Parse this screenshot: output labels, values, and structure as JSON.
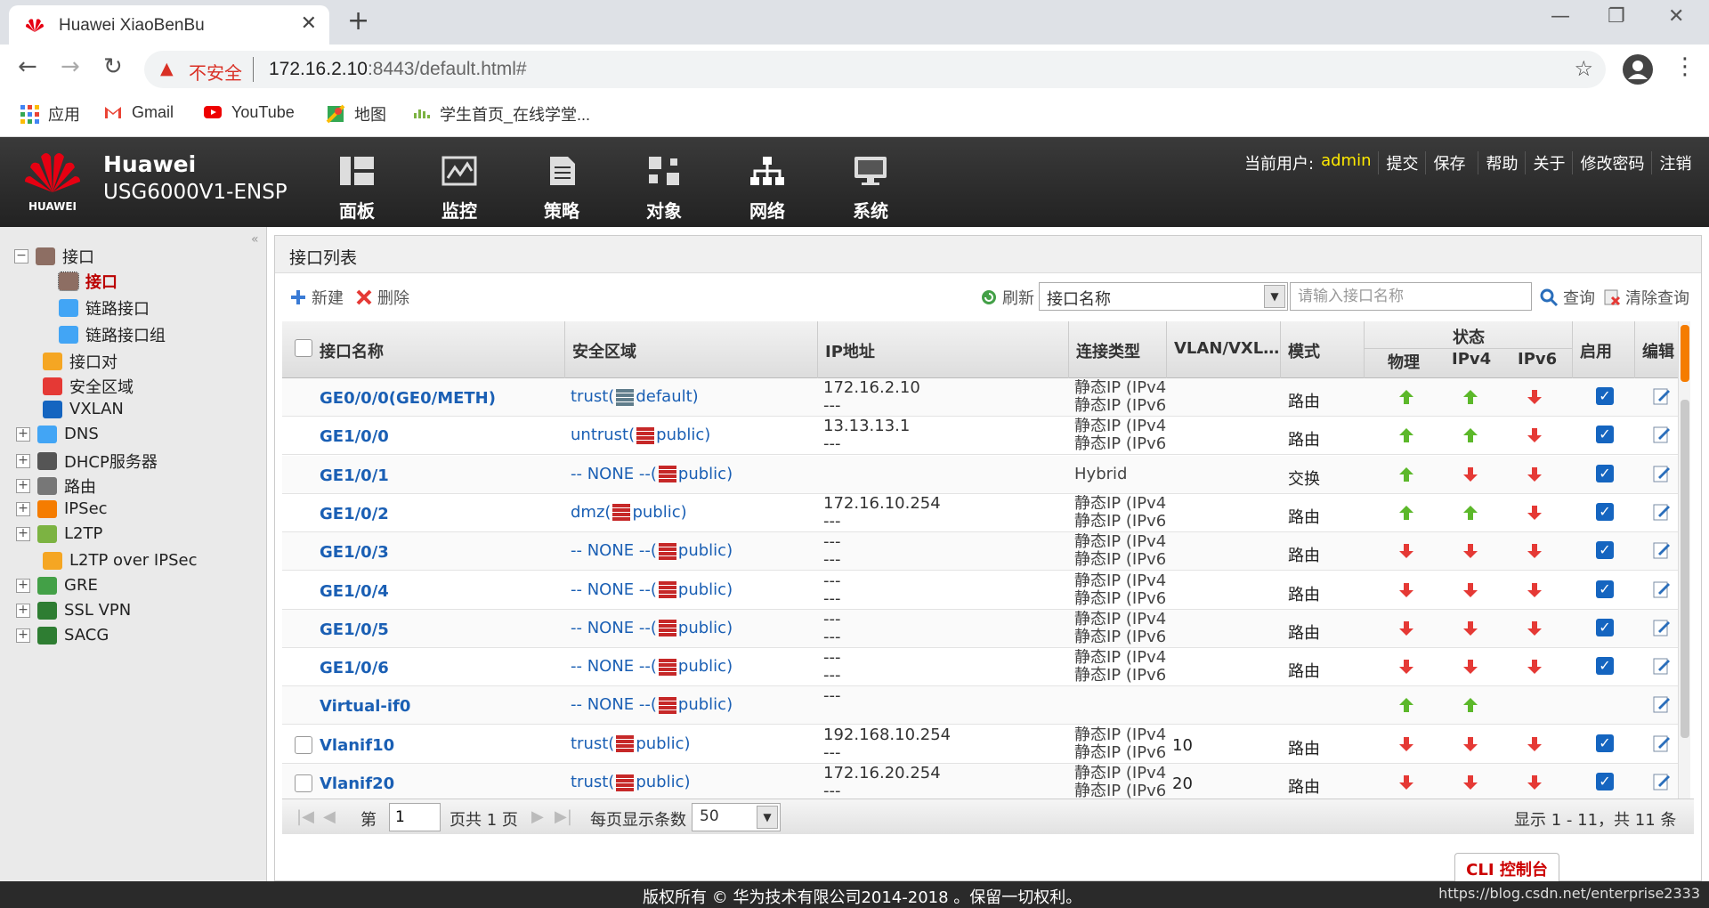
{
  "browser": {
    "tab_title": "Huawei XiaoBenBu",
    "insecure_label": "不安全",
    "url_host": "172.16.2.10",
    "url_rest": ":8443/default.html#",
    "bookmarks": [
      "应用",
      "Gmail",
      "YouTube",
      "地图",
      "学生首页_在线学堂..."
    ]
  },
  "app": {
    "brand_line1": "Huawei",
    "brand_line2": "USG6000V1-ENSP",
    "logo_text": "HUAWEI",
    "nav": [
      "面板",
      "监控",
      "策略",
      "对象",
      "网络",
      "系统"
    ],
    "user_label": "当前用户:",
    "user_name": "admin",
    "user_links": [
      "提交",
      "保存",
      "帮助",
      "关于",
      "修改密码",
      "注销"
    ]
  },
  "sidebar": {
    "items": [
      {
        "label": "接口",
        "expander": "−"
      },
      {
        "label": "接口"
      },
      {
        "label": "链路接口"
      },
      {
        "label": "链路接口组"
      },
      {
        "label": "接口对"
      },
      {
        "label": "安全区域"
      },
      {
        "label": "VXLAN"
      },
      {
        "label": "DNS",
        "expander": "+"
      },
      {
        "label": "DHCP服务器",
        "expander": "+"
      },
      {
        "label": "路由",
        "expander": "+"
      },
      {
        "label": "IPSec",
        "expander": "+"
      },
      {
        "label": "L2TP",
        "expander": "+"
      },
      {
        "label": "L2TP over IPSec"
      },
      {
        "label": "GRE",
        "expander": "+"
      },
      {
        "label": "SSL VPN",
        "expander": "+"
      },
      {
        "label": "SACG",
        "expander": "+"
      }
    ]
  },
  "panel": {
    "title": "接口列表",
    "new_label": "新建",
    "delete_label": "删除",
    "refresh_label": "刷新",
    "filter_field": "接口名称",
    "search_placeholder": "请输入接口名称",
    "search_label": "查询",
    "clear_label": "清除查询"
  },
  "table": {
    "headers": {
      "name": "接口名称",
      "zone": "安全区域",
      "ip": "IP地址",
      "conn": "连接类型",
      "vlan": "VLAN/VXL…",
      "mode": "模式",
      "status": "状态",
      "phys": "物理",
      "ipv4": "IPv4",
      "ipv6": "IPv6",
      "enable": "启用",
      "edit": "编辑"
    },
    "rows": [
      {
        "name": "GE0/0/0(GE0/METH)",
        "zone_pre": "trust(",
        "zone_post": "default)",
        "ip1": "172.16.2.10",
        "ip2": "---",
        "conn1": "静态IP (IPv4",
        "conn2": "静态IP (IPv6",
        "vlan": "",
        "mode": "路由",
        "phys": "up",
        "ipv4": "up",
        "ipv6": "down",
        "enabled": true,
        "checkbox": false
      },
      {
        "name": "GE1/0/0",
        "zone_pre": "untrust(",
        "zone_post": "public)",
        "ip1": "13.13.13.1",
        "ip2": "---",
        "conn1": "静态IP (IPv4",
        "conn2": "静态IP (IPv6",
        "vlan": "",
        "mode": "路由",
        "phys": "up",
        "ipv4": "up",
        "ipv6": "down",
        "enabled": true,
        "checkbox": false
      },
      {
        "name": "GE1/0/1",
        "zone_pre": "-- NONE --(",
        "zone_post": "public)",
        "ip1": "",
        "ip2": "",
        "conn1": "Hybrid",
        "conn2": "",
        "vlan": "",
        "mode": "交换",
        "phys": "up",
        "ipv4": "down",
        "ipv6": "down",
        "enabled": true,
        "checkbox": false
      },
      {
        "name": "GE1/0/2",
        "zone_pre": "dmz(",
        "zone_post": "public)",
        "ip1": "172.16.10.254",
        "ip2": "---",
        "conn1": "静态IP (IPv4",
        "conn2": "静态IP (IPv6",
        "vlan": "",
        "mode": "路由",
        "phys": "up",
        "ipv4": "up",
        "ipv6": "down",
        "enabled": true,
        "checkbox": false
      },
      {
        "name": "GE1/0/3",
        "zone_pre": "-- NONE --(",
        "zone_post": "public)",
        "ip1": "---",
        "ip2": "---",
        "conn1": "静态IP (IPv4",
        "conn2": "静态IP (IPv6",
        "vlan": "",
        "mode": "路由",
        "phys": "down",
        "ipv4": "down",
        "ipv6": "down",
        "enabled": true,
        "checkbox": false
      },
      {
        "name": "GE1/0/4",
        "zone_pre": "-- NONE --(",
        "zone_post": "public)",
        "ip1": "---",
        "ip2": "---",
        "conn1": "静态IP (IPv4",
        "conn2": "静态IP (IPv6",
        "vlan": "",
        "mode": "路由",
        "phys": "down",
        "ipv4": "down",
        "ipv6": "down",
        "enabled": true,
        "checkbox": false
      },
      {
        "name": "GE1/0/5",
        "zone_pre": "-- NONE --(",
        "zone_post": "public)",
        "ip1": "---",
        "ip2": "---",
        "conn1": "静态IP (IPv4",
        "conn2": "静态IP (IPv6",
        "vlan": "",
        "mode": "路由",
        "phys": "down",
        "ipv4": "down",
        "ipv6": "down",
        "enabled": true,
        "checkbox": false
      },
      {
        "name": "GE1/0/6",
        "zone_pre": "-- NONE --(",
        "zone_post": "public)",
        "ip1": "---",
        "ip2": "---",
        "conn1": "静态IP (IPv4",
        "conn2": "静态IP (IPv6",
        "vlan": "",
        "mode": "路由",
        "phys": "down",
        "ipv4": "down",
        "ipv6": "down",
        "enabled": true,
        "checkbox": false
      },
      {
        "name": "Virtual-if0",
        "zone_pre": "-- NONE --(",
        "zone_post": "public)",
        "ip1": "---",
        "ip2": "",
        "conn1": "",
        "conn2": "",
        "vlan": "",
        "mode": "",
        "phys": "up",
        "ipv4": "up",
        "ipv6": "",
        "enabled": null,
        "checkbox": false
      },
      {
        "name": "Vlanif10",
        "zone_pre": "trust(",
        "zone_post": "public)",
        "ip1": "192.168.10.254",
        "ip2": "---",
        "conn1": "静态IP (IPv4",
        "conn2": "静态IP (IPv6",
        "vlan": "10",
        "mode": "路由",
        "phys": "down",
        "ipv4": "down",
        "ipv6": "down",
        "enabled": true,
        "checkbox": true
      },
      {
        "name": "Vlanif20",
        "zone_pre": "trust(",
        "zone_post": "public)",
        "ip1": "172.16.20.254",
        "ip2": "---",
        "conn1": "静态IP (IPv4",
        "conn2": "静态IP (IPv6",
        "vlan": "20",
        "mode": "路由",
        "phys": "down",
        "ipv4": "down",
        "ipv6": "down",
        "enabled": true,
        "checkbox": true
      }
    ]
  },
  "pager": {
    "page_prefix": "第",
    "page_value": "1",
    "page_suffix": "页共 1 页",
    "pagesize_label": "每页显示条数",
    "pagesize_value": "50",
    "summary": "显示 1 - 11，共 11 条"
  },
  "cli_label": "CLI 控制台",
  "footer": {
    "copyright": "版权所有 © 华为技术有限公司2014-2018 。保留一切权利。",
    "watermark": "https://blog.csdn.net/enterprise2333"
  },
  "colors": {
    "up": "#5cb82a",
    "down": "#e53935",
    "link": "#1a5fb4",
    "accent": "#f57c00"
  }
}
